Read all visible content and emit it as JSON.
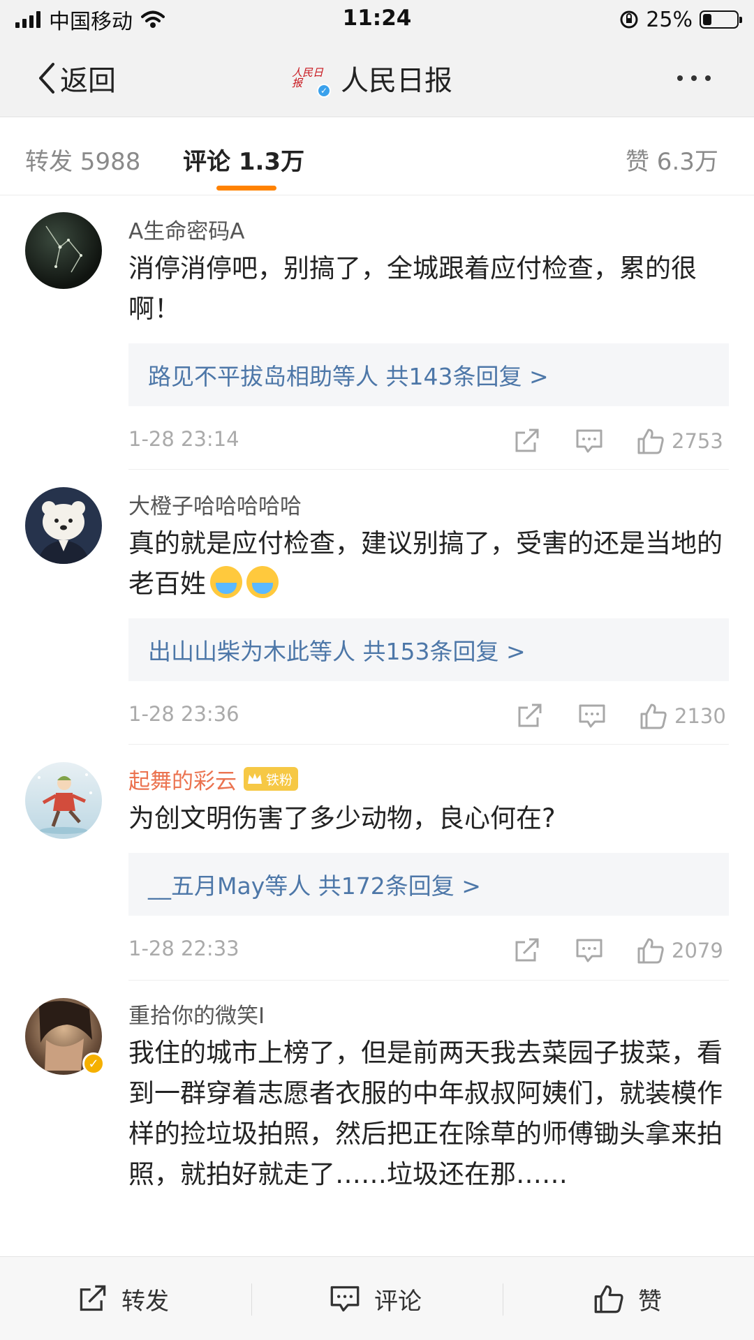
{
  "status_bar": {
    "carrier": "中国移动",
    "time": "11:24",
    "battery_percent": "25%",
    "battery_level": 0.25
  },
  "nav": {
    "back_label": "返回",
    "logo_text": "人民日报",
    "title": "人民日报"
  },
  "tabs": {
    "repost": "转发 5988",
    "comments": "评论 1.3万",
    "likes": "赞 6.3万"
  },
  "comments": [
    {
      "username": "A生命密码A",
      "text": "消停消停吧，别搞了，全城跟着应付检查，累的很啊！",
      "reply_summary": "路见不平拔岛相助等人  共143条回复 >",
      "date": "1-28 23:14",
      "likes": "2753"
    },
    {
      "username": "大橙子哈哈哈哈哈",
      "text": "真的就是应付检查，建议别搞了，受害的还是当地的老百姓",
      "reply_summary": "出山山柴为木此等人  共153条回复 >",
      "date": "1-28 23:36",
      "likes": "2130"
    },
    {
      "username": "起舞的彩云",
      "badge": "铁粉",
      "text": "为创文明伤害了多少动物，良心何在?",
      "reply_summary": "__五月May等人  共172条回复 >",
      "date": "1-28 22:33",
      "likes": "2079"
    },
    {
      "username": "重拾你的微笑I",
      "text": "我住的城市上榜了，但是前两天我去菜园子拔菜，看到一群穿着志愿者衣服的中年叔叔阿姨们，就装模作样的捡垃圾拍照，然后把正在除草的师傅锄头拿来拍照，就拍好就走了……垃圾还在那……"
    }
  ],
  "bottom_bar": {
    "repost": "转发",
    "comment": "评论",
    "like": "赞"
  },
  "colors": {
    "accent": "#ff8200",
    "link": "#4d77a8",
    "username_highlight": "#eb7350"
  }
}
